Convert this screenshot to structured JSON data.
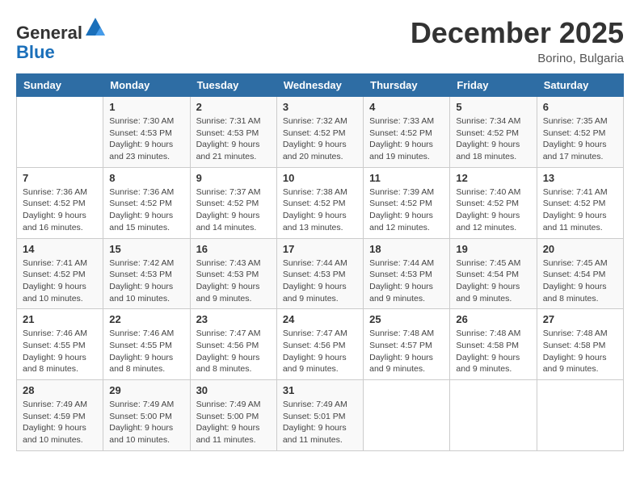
{
  "logo": {
    "general": "General",
    "blue": "Blue"
  },
  "title": "December 2025",
  "location": "Borino, Bulgaria",
  "days_of_week": [
    "Sunday",
    "Monday",
    "Tuesday",
    "Wednesday",
    "Thursday",
    "Friday",
    "Saturday"
  ],
  "weeks": [
    [
      {
        "day": "",
        "info": ""
      },
      {
        "day": "1",
        "info": "Sunrise: 7:30 AM\nSunset: 4:53 PM\nDaylight: 9 hours\nand 23 minutes."
      },
      {
        "day": "2",
        "info": "Sunrise: 7:31 AM\nSunset: 4:53 PM\nDaylight: 9 hours\nand 21 minutes."
      },
      {
        "day": "3",
        "info": "Sunrise: 7:32 AM\nSunset: 4:52 PM\nDaylight: 9 hours\nand 20 minutes."
      },
      {
        "day": "4",
        "info": "Sunrise: 7:33 AM\nSunset: 4:52 PM\nDaylight: 9 hours\nand 19 minutes."
      },
      {
        "day": "5",
        "info": "Sunrise: 7:34 AM\nSunset: 4:52 PM\nDaylight: 9 hours\nand 18 minutes."
      },
      {
        "day": "6",
        "info": "Sunrise: 7:35 AM\nSunset: 4:52 PM\nDaylight: 9 hours\nand 17 minutes."
      }
    ],
    [
      {
        "day": "7",
        "info": "Sunrise: 7:36 AM\nSunset: 4:52 PM\nDaylight: 9 hours\nand 16 minutes."
      },
      {
        "day": "8",
        "info": "Sunrise: 7:36 AM\nSunset: 4:52 PM\nDaylight: 9 hours\nand 15 minutes."
      },
      {
        "day": "9",
        "info": "Sunrise: 7:37 AM\nSunset: 4:52 PM\nDaylight: 9 hours\nand 14 minutes."
      },
      {
        "day": "10",
        "info": "Sunrise: 7:38 AM\nSunset: 4:52 PM\nDaylight: 9 hours\nand 13 minutes."
      },
      {
        "day": "11",
        "info": "Sunrise: 7:39 AM\nSunset: 4:52 PM\nDaylight: 9 hours\nand 12 minutes."
      },
      {
        "day": "12",
        "info": "Sunrise: 7:40 AM\nSunset: 4:52 PM\nDaylight: 9 hours\nand 12 minutes."
      },
      {
        "day": "13",
        "info": "Sunrise: 7:41 AM\nSunset: 4:52 PM\nDaylight: 9 hours\nand 11 minutes."
      }
    ],
    [
      {
        "day": "14",
        "info": "Sunrise: 7:41 AM\nSunset: 4:52 PM\nDaylight: 9 hours\nand 10 minutes."
      },
      {
        "day": "15",
        "info": "Sunrise: 7:42 AM\nSunset: 4:53 PM\nDaylight: 9 hours\nand 10 minutes."
      },
      {
        "day": "16",
        "info": "Sunrise: 7:43 AM\nSunset: 4:53 PM\nDaylight: 9 hours\nand 9 minutes."
      },
      {
        "day": "17",
        "info": "Sunrise: 7:44 AM\nSunset: 4:53 PM\nDaylight: 9 hours\nand 9 minutes."
      },
      {
        "day": "18",
        "info": "Sunrise: 7:44 AM\nSunset: 4:53 PM\nDaylight: 9 hours\nand 9 minutes."
      },
      {
        "day": "19",
        "info": "Sunrise: 7:45 AM\nSunset: 4:54 PM\nDaylight: 9 hours\nand 9 minutes."
      },
      {
        "day": "20",
        "info": "Sunrise: 7:45 AM\nSunset: 4:54 PM\nDaylight: 9 hours\nand 8 minutes."
      }
    ],
    [
      {
        "day": "21",
        "info": "Sunrise: 7:46 AM\nSunset: 4:55 PM\nDaylight: 9 hours\nand 8 minutes."
      },
      {
        "day": "22",
        "info": "Sunrise: 7:46 AM\nSunset: 4:55 PM\nDaylight: 9 hours\nand 8 minutes."
      },
      {
        "day": "23",
        "info": "Sunrise: 7:47 AM\nSunset: 4:56 PM\nDaylight: 9 hours\nand 8 minutes."
      },
      {
        "day": "24",
        "info": "Sunrise: 7:47 AM\nSunset: 4:56 PM\nDaylight: 9 hours\nand 9 minutes."
      },
      {
        "day": "25",
        "info": "Sunrise: 7:48 AM\nSunset: 4:57 PM\nDaylight: 9 hours\nand 9 minutes."
      },
      {
        "day": "26",
        "info": "Sunrise: 7:48 AM\nSunset: 4:58 PM\nDaylight: 9 hours\nand 9 minutes."
      },
      {
        "day": "27",
        "info": "Sunrise: 7:48 AM\nSunset: 4:58 PM\nDaylight: 9 hours\nand 9 minutes."
      }
    ],
    [
      {
        "day": "28",
        "info": "Sunrise: 7:49 AM\nSunset: 4:59 PM\nDaylight: 9 hours\nand 10 minutes."
      },
      {
        "day": "29",
        "info": "Sunrise: 7:49 AM\nSunset: 5:00 PM\nDaylight: 9 hours\nand 10 minutes."
      },
      {
        "day": "30",
        "info": "Sunrise: 7:49 AM\nSunset: 5:00 PM\nDaylight: 9 hours\nand 11 minutes."
      },
      {
        "day": "31",
        "info": "Sunrise: 7:49 AM\nSunset: 5:01 PM\nDaylight: 9 hours\nand 11 minutes."
      },
      {
        "day": "",
        "info": ""
      },
      {
        "day": "",
        "info": ""
      },
      {
        "day": "",
        "info": ""
      }
    ]
  ]
}
